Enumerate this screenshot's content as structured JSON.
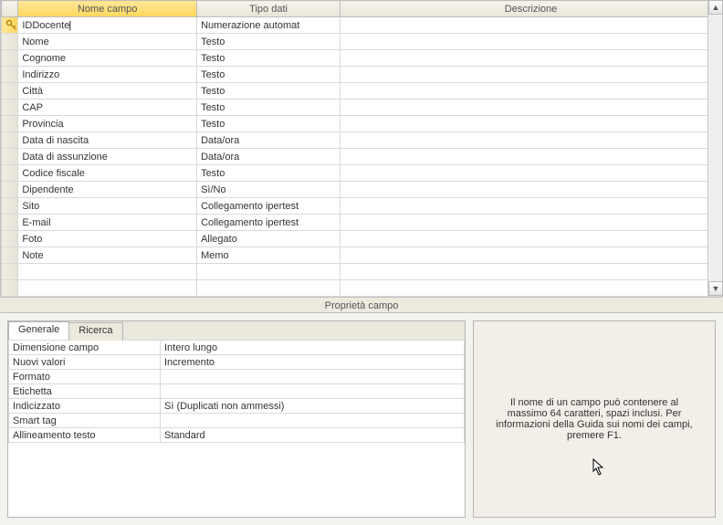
{
  "columns": {
    "field_name": "Nome campo",
    "data_type": "Tipo dati",
    "description": "Descrizione"
  },
  "fields": [
    {
      "name": "IDDocente",
      "type": "Numerazione automat",
      "desc": "",
      "isPrimaryKey": true,
      "active": true
    },
    {
      "name": "Nome",
      "type": "Testo",
      "desc": ""
    },
    {
      "name": "Cognome",
      "type": "Testo",
      "desc": ""
    },
    {
      "name": "Indirizzo",
      "type": "Testo",
      "desc": ""
    },
    {
      "name": "Città",
      "type": "Testo",
      "desc": ""
    },
    {
      "name": "CAP",
      "type": "Testo",
      "desc": ""
    },
    {
      "name": "Provincia",
      "type": "Testo",
      "desc": ""
    },
    {
      "name": "Data di nascita",
      "type": "Data/ora",
      "desc": ""
    },
    {
      "name": "Data di assunzione",
      "type": "Data/ora",
      "desc": ""
    },
    {
      "name": "Codice fiscale",
      "type": "Testo",
      "desc": ""
    },
    {
      "name": "Dipendente",
      "type": "Sì/No",
      "desc": ""
    },
    {
      "name": "Sito",
      "type": "Collegamento ipertest",
      "desc": ""
    },
    {
      "name": "E-mail",
      "type": "Collegamento ipertest",
      "desc": ""
    },
    {
      "name": "Foto",
      "type": "Allegato",
      "desc": ""
    },
    {
      "name": "Note",
      "type": "Memo",
      "desc": ""
    },
    {
      "name": "",
      "type": "",
      "desc": ""
    },
    {
      "name": "",
      "type": "",
      "desc": ""
    }
  ],
  "section_header": "Proprietà campo",
  "tabs": {
    "general": "Generale",
    "lookup": "Ricerca"
  },
  "properties": [
    {
      "label": "Dimensione campo",
      "value": "Intero lungo"
    },
    {
      "label": "Nuovi valori",
      "value": "Incremento"
    },
    {
      "label": "Formato",
      "value": ""
    },
    {
      "label": "Etichetta",
      "value": ""
    },
    {
      "label": "Indicizzato",
      "value": "Sì (Duplicati non ammessi)"
    },
    {
      "label": "Smart tag",
      "value": ""
    },
    {
      "label": "Allineamento testo",
      "value": "Standard"
    }
  ],
  "help_text": "Il nome di un campo può contenere al massimo 64 caratteri, spazi inclusi. Per informazioni della Guida sui nomi dei campi, premere F1."
}
